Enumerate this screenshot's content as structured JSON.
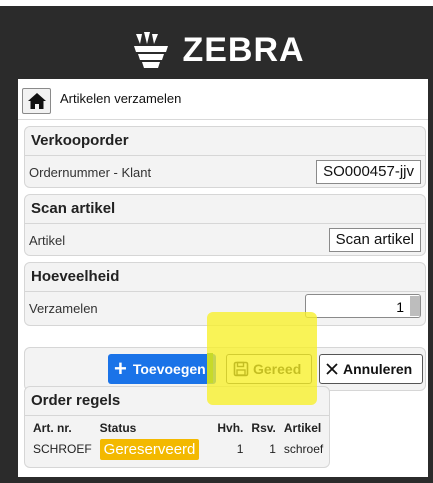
{
  "logo": {
    "text": "ZEBRA",
    "icon": "zebra-head-icon"
  },
  "nav": {
    "title": "Artikelen verzamelen",
    "home_icon": "home-icon"
  },
  "sales_order": {
    "heading": "Verkooporder",
    "label": "Ordernummer - Klant",
    "value": "SO000457-jjv"
  },
  "scan": {
    "heading": "Scan artikel",
    "label": "Artikel",
    "button": "Scan artikel"
  },
  "quantity": {
    "heading": "Hoeveelheid",
    "label": "Verzamelen",
    "value": "1"
  },
  "actions": {
    "add_label": "Toevoegen",
    "done_label": "Gereed",
    "cancel_label": "Annuleren",
    "add_color": "#1a73e8"
  },
  "order_lines": {
    "heading": "Order regels",
    "columns": [
      "Art. nr.",
      "Status",
      "Hvh.",
      "Rsv.",
      "Artikel"
    ],
    "rows": [
      {
        "art_nr": "SCHROEF",
        "status": "Gereserveerd",
        "hvh": "1",
        "rsv": "1",
        "artikel": "schroef"
      }
    ],
    "status_color": "#f3b900"
  },
  "highlight_color": "#f7f028"
}
